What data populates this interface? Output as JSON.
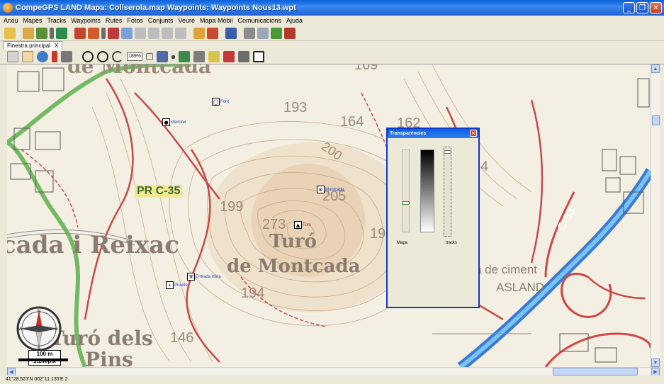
{
  "window": {
    "title": "CompeGPS LAND Mapa: Collserola.map Waypoints:  Waypoints Nous13.wpt"
  },
  "menu": [
    "Arxiu",
    "Mapes",
    "Tracks",
    "Waypoints",
    "Rutes",
    "Fotos",
    "Conjunts",
    "Veure",
    "Mapa Mòbil",
    "Comunicacions",
    "Ajuda"
  ],
  "tab": {
    "label": "Finestra principal",
    "close": "X"
  },
  "toolbar2": {
    "zoom": "189%"
  },
  "map": {
    "contour_labels": [
      "193",
      "164",
      "162",
      "199",
      "205",
      "273",
      "194",
      "146",
      "19",
      "4",
      "169"
    ],
    "place_labels": [
      "de Montcada",
      "cada i Reixac",
      "Turó",
      "de Montcada",
      "Turó dels",
      "Pins",
      "a de ciment",
      "ASLAND",
      "C-33",
      "200"
    ],
    "route_label": "PR C-35",
    "waypoints": [
      {
        "label": "Font",
        "icon": "font-icon"
      },
      {
        "label": "Mercirer",
        "icon": "dot-icon"
      },
      {
        "label": "Montcada",
        "icon": "mine-icon"
      },
      {
        "label": "Turó",
        "icon": "summit-icon"
      },
      {
        "label": "Entrada mina",
        "icon": "mine-entrance-icon"
      },
      {
        "label": "Pruelle",
        "icon": "dot-icon"
      }
    ],
    "scale": {
      "distance": "100 m",
      "resolution": "1.1m/pix"
    },
    "compass": {
      "north": "N",
      "east": "E",
      "south": "S",
      "west": "W"
    }
  },
  "dialog": {
    "title": "Transparències",
    "close": "×",
    "labels": [
      "Mapa",
      "tracks"
    ],
    "mapa_transparency": 0.35,
    "tracks_transparency": 0.97
  },
  "status": {
    "coordinates": "41°28.523'N 002°11.135'E  2"
  }
}
